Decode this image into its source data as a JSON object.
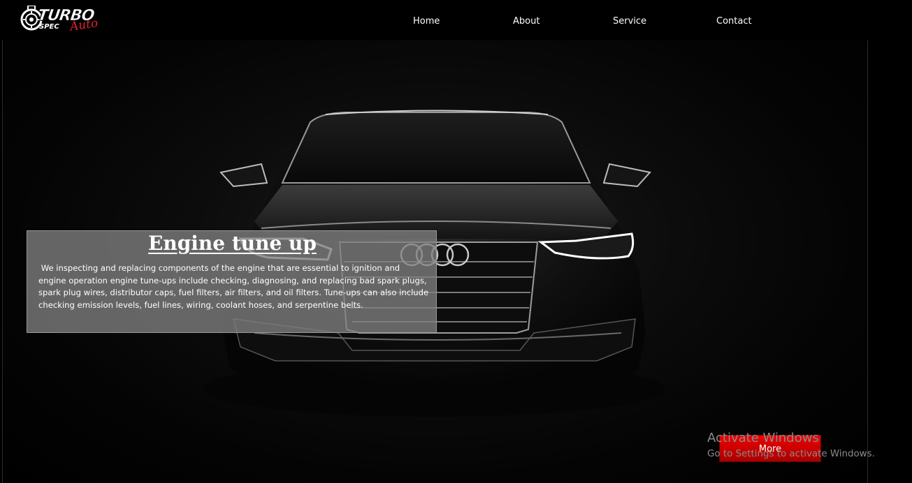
{
  "brand": {
    "logo_word_1": "TURBO",
    "logo_word_2": "SPEC",
    "logo_word_3": "Auto",
    "accent_color": "#e0222f"
  },
  "nav": {
    "items": [
      {
        "label": "Home"
      },
      {
        "label": "About"
      },
      {
        "label": "Service"
      },
      {
        "label": "Contact"
      }
    ]
  },
  "hero": {
    "title": "Engine tune up",
    "description": " We inspecting and replacing components of the engine that are essential to ignition and engine operation engine tune-ups include checking, diagnosing, and replacing bad spark plugs, spark plug wires, distributor caps, fuel filters, air filters, and oil filters. Tune-ups can also include checking emission levels, fuel lines, wiring, coolant hoses, and serpentine belts.",
    "more_label": "More",
    "button_color": "#d40000"
  },
  "os_overlay": {
    "title": "Activate Windows",
    "subtitle": "Go to Settings to activate Windows."
  },
  "icons": {
    "logo": "turbo-spec-logo-icon",
    "car": "car-image"
  }
}
